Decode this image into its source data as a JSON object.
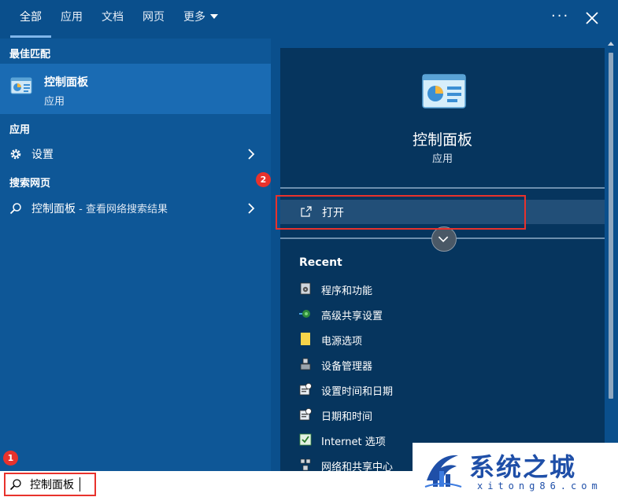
{
  "tabs": [
    {
      "label": "全部",
      "active": true
    },
    {
      "label": "应用",
      "active": false
    },
    {
      "label": "文档",
      "active": false
    },
    {
      "label": "网页",
      "active": false
    },
    {
      "label": "更多",
      "active": false
    }
  ],
  "topbar": {
    "more_options": "···"
  },
  "left": {
    "best_match_title": "最佳匹配",
    "best_match": {
      "name": "控制面板",
      "type": "应用"
    },
    "apps_title": "应用",
    "apps": [
      {
        "label": "设置"
      }
    ],
    "web_title": "搜索网页",
    "web_result": {
      "label": "控制面板",
      "suffix": " - 查看网络搜索结果"
    }
  },
  "right": {
    "title": "控制面板",
    "subtitle": "应用",
    "open_label": "打开",
    "recent_title": "Recent",
    "recent": [
      {
        "label": "程序和功能",
        "icon": "programs-icon"
      },
      {
        "label": "高级共享设置",
        "icon": "network-share-icon"
      },
      {
        "label": "电源选项",
        "icon": "power-icon"
      },
      {
        "label": "设备管理器",
        "icon": "device-manager-icon"
      },
      {
        "label": "设置时间和日期",
        "icon": "clock-icon"
      },
      {
        "label": "日期和时间",
        "icon": "calendar-icon"
      },
      {
        "label": "Internet 选项",
        "icon": "internet-options-icon"
      },
      {
        "label": "网络和共享中心",
        "icon": "network-center-icon"
      }
    ]
  },
  "search": {
    "value": "控制面板"
  },
  "annotations": {
    "badge1": "1",
    "badge2": "2"
  },
  "watermark": {
    "title": "系统之城",
    "subtitle": "xitong86.com"
  },
  "colors": {
    "accent": "#0a4f8c",
    "panel": "#06355e",
    "highlight": "#e8322c"
  }
}
